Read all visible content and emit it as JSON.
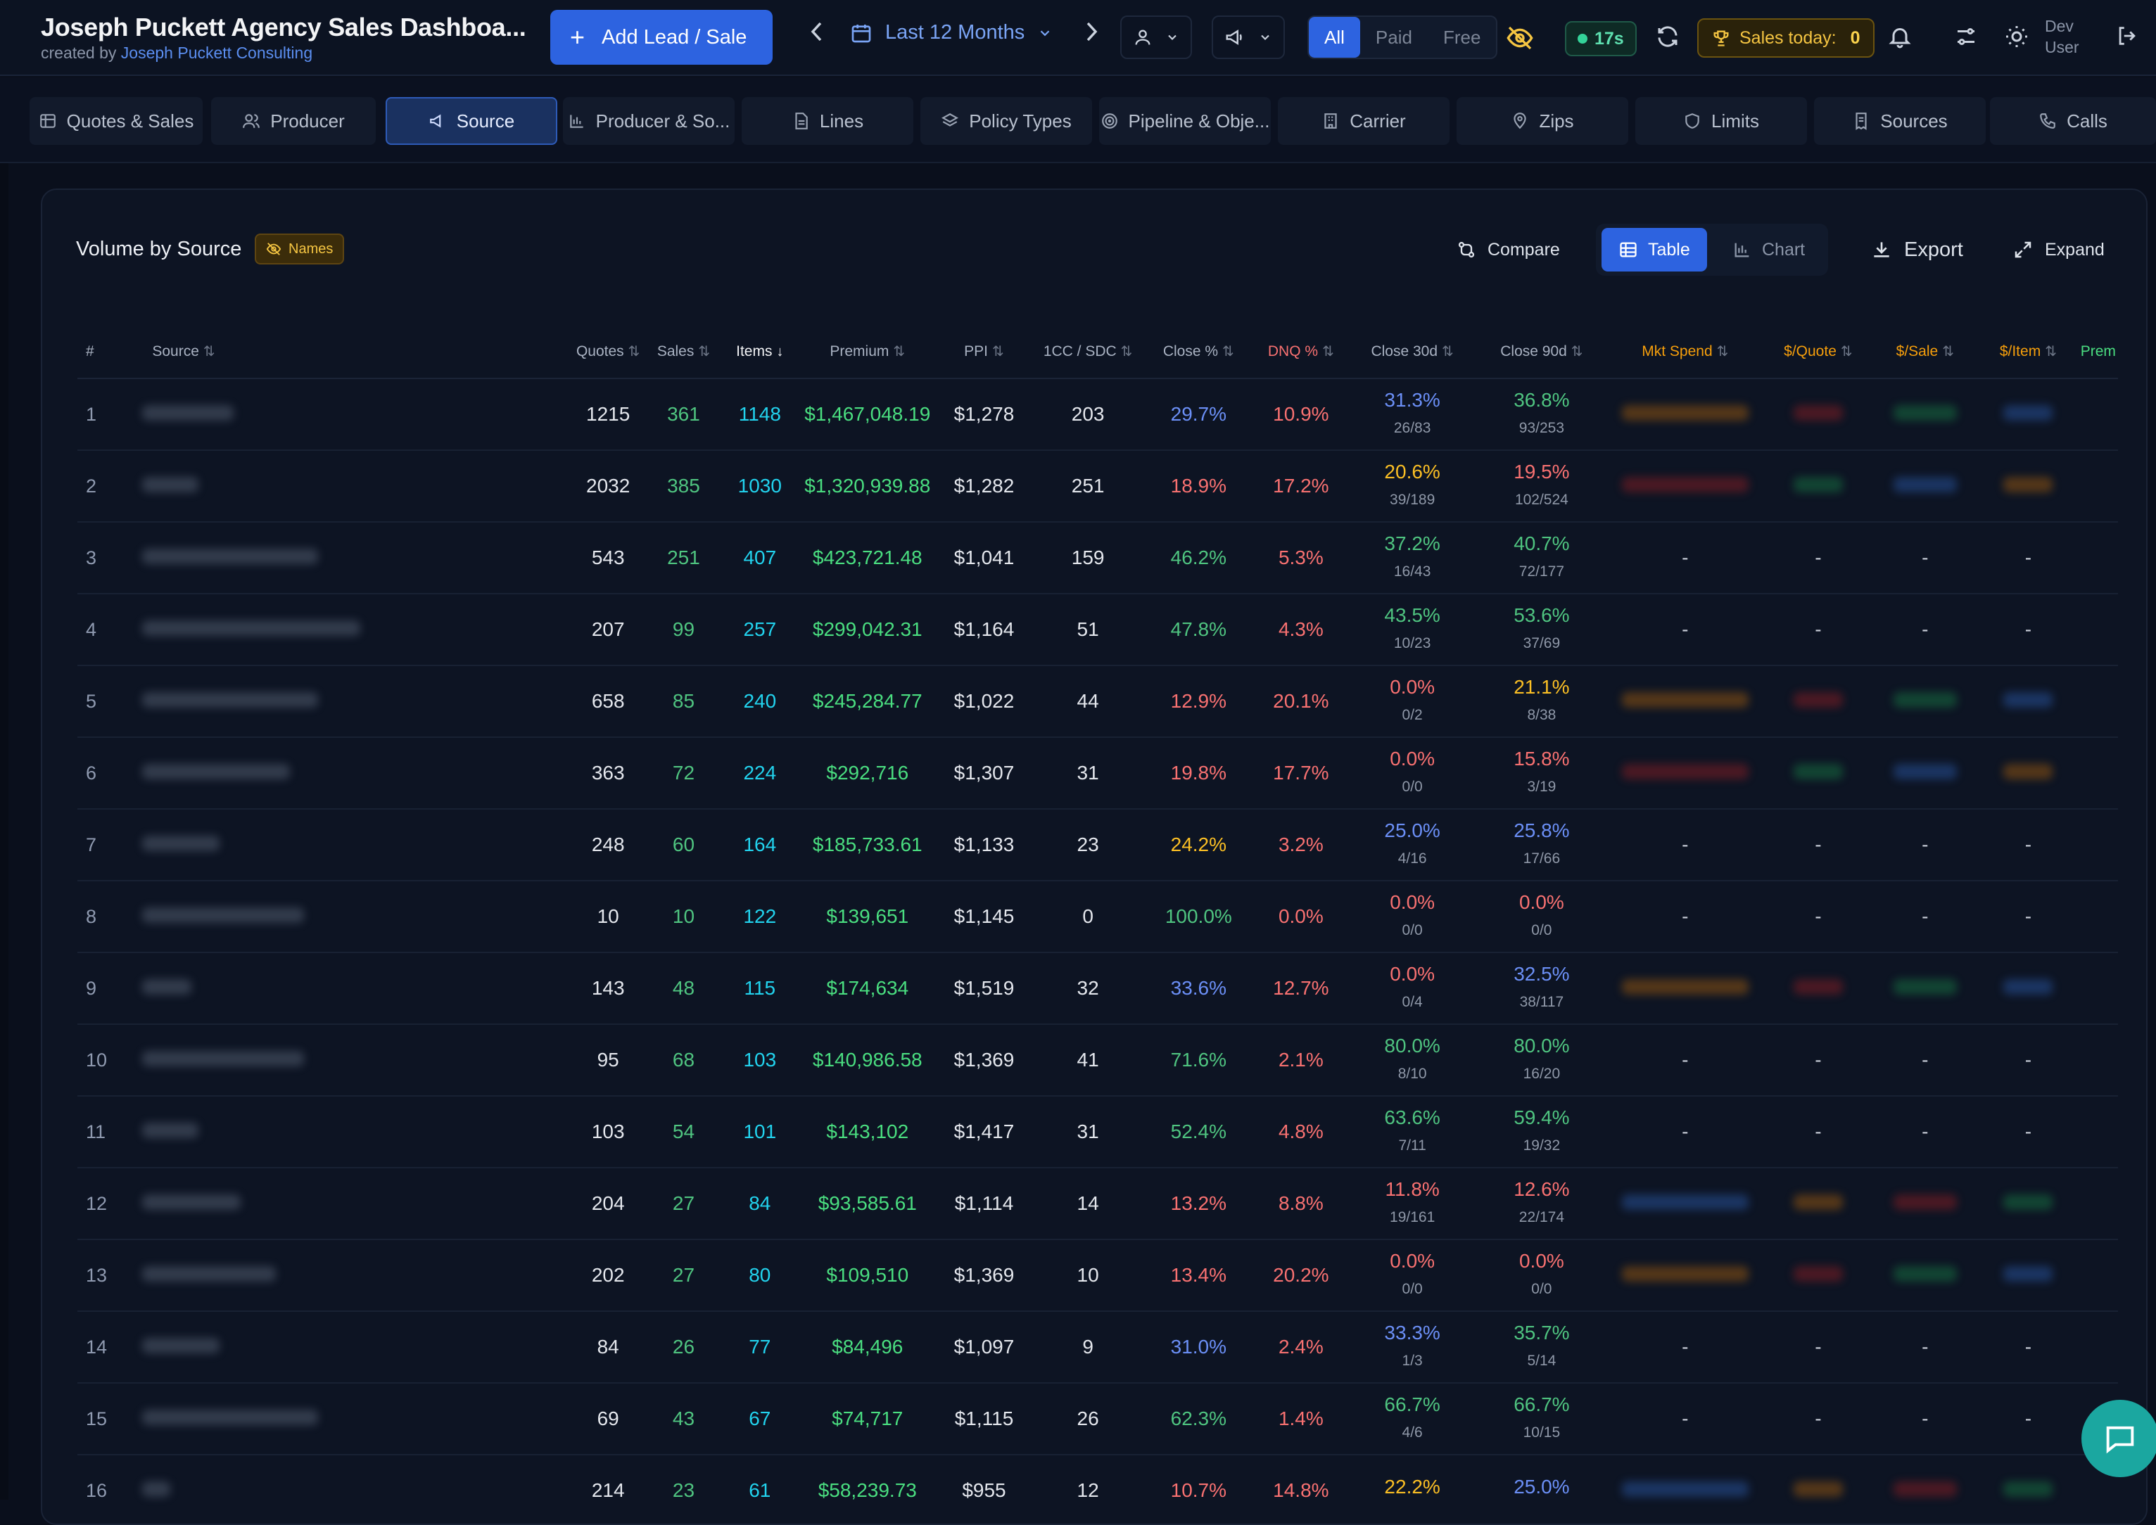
{
  "app": {
    "title": "Joseph Puckett Agency Sales Dashboa...",
    "created_by_prefix": "created by",
    "created_by_name": "Joseph Puckett Consulting"
  },
  "toolbar": {
    "add_label": "Add Lead / Sale",
    "date_range": "Last 12 Months",
    "filter_segment": [
      "All",
      "Paid",
      "Free"
    ],
    "timer": "17s",
    "sales_today_label": "Sales today:",
    "sales_today_value": "0",
    "user_line1": "Dev",
    "user_line2": "User"
  },
  "tabs": [
    {
      "label": "Quotes & Sales",
      "icon": "table-icon"
    },
    {
      "label": "Producer",
      "icon": "users-icon"
    },
    {
      "label": "Source",
      "icon": "megaphone-icon",
      "active": true
    },
    {
      "label": "Producer & So...",
      "icon": "bar-chart-icon"
    },
    {
      "label": "Lines",
      "icon": "file-icon"
    },
    {
      "label": "Policy Types",
      "icon": "layers-icon"
    },
    {
      "label": "Pipeline & Obje...",
      "icon": "target-icon"
    },
    {
      "label": "Carrier",
      "icon": "building-icon"
    },
    {
      "label": "Zips",
      "icon": "map-pin-icon"
    },
    {
      "label": "Limits",
      "icon": "shield-icon"
    },
    {
      "label": "Sources",
      "icon": "receipt-icon"
    },
    {
      "label": "Calls",
      "icon": "phone-icon"
    }
  ],
  "card": {
    "title": "Volume by Source",
    "badge": "Names",
    "compare_label": "Compare",
    "table_label": "Table",
    "chart_label": "Chart",
    "export_label": "Export",
    "expand_label": "Expand"
  },
  "columns": [
    "#",
    "Source",
    "Quotes",
    "Sales",
    "Items",
    "Premium",
    "PPI",
    "1CC / SDC",
    "Close %",
    "DNQ %",
    "Close 30d",
    "Close 90d",
    "Mkt Spend",
    "$/Quote",
    "$/Sale",
    "$/Item",
    "Prem"
  ],
  "rows": [
    {
      "rank": "1",
      "quotes": "1215",
      "sales": "361",
      "items": "1148",
      "premium": "$1,467,048.19",
      "ppi": "$1,278",
      "cc": "203",
      "close": "29.7%",
      "dnq": "10.9%",
      "c30": "31.3%",
      "c30s": "26/83",
      "c90": "36.8%",
      "c90s": "93/253",
      "dash": false
    },
    {
      "rank": "2",
      "quotes": "2032",
      "sales": "385",
      "items": "1030",
      "premium": "$1,320,939.88",
      "ppi": "$1,282",
      "cc": "251",
      "close": "18.9%",
      "dnq": "17.2%",
      "c30": "20.6%",
      "c30s": "39/189",
      "c90": "19.5%",
      "c90s": "102/524",
      "dash": false
    },
    {
      "rank": "3",
      "quotes": "543",
      "sales": "251",
      "items": "407",
      "premium": "$423,721.48",
      "ppi": "$1,041",
      "cc": "159",
      "close": "46.2%",
      "dnq": "5.3%",
      "c30": "37.2%",
      "c30s": "16/43",
      "c90": "40.7%",
      "c90s": "72/177",
      "dash": true
    },
    {
      "rank": "4",
      "quotes": "207",
      "sales": "99",
      "items": "257",
      "premium": "$299,042.31",
      "ppi": "$1,164",
      "cc": "51",
      "close": "47.8%",
      "dnq": "4.3%",
      "c30": "43.5%",
      "c30s": "10/23",
      "c90": "53.6%",
      "c90s": "37/69",
      "dash": true
    },
    {
      "rank": "5",
      "quotes": "658",
      "sales": "85",
      "items": "240",
      "premium": "$245,284.77",
      "ppi": "$1,022",
      "cc": "44",
      "close": "12.9%",
      "dnq": "20.1%",
      "c30": "0.0%",
      "c30s": "0/2",
      "c90": "21.1%",
      "c90s": "8/38",
      "dash": false
    },
    {
      "rank": "6",
      "quotes": "363",
      "sales": "72",
      "items": "224",
      "premium": "$292,716",
      "ppi": "$1,307",
      "cc": "31",
      "close": "19.8%",
      "dnq": "17.7%",
      "c30": "0.0%",
      "c30s": "0/0",
      "c90": "15.8%",
      "c90s": "3/19",
      "dash": false
    },
    {
      "rank": "7",
      "quotes": "248",
      "sales": "60",
      "items": "164",
      "premium": "$185,733.61",
      "ppi": "$1,133",
      "cc": "23",
      "close": "24.2%",
      "dnq": "3.2%",
      "c30": "25.0%",
      "c30s": "4/16",
      "c90": "25.8%",
      "c90s": "17/66",
      "dash": true
    },
    {
      "rank": "8",
      "quotes": "10",
      "sales": "10",
      "items": "122",
      "premium": "$139,651",
      "ppi": "$1,145",
      "cc": "0",
      "close": "100.0%",
      "dnq": "0.0%",
      "c30": "0.0%",
      "c30s": "0/0",
      "c90": "0.0%",
      "c90s": "0/0",
      "dash": true
    },
    {
      "rank": "9",
      "quotes": "143",
      "sales": "48",
      "items": "115",
      "premium": "$174,634",
      "ppi": "$1,519",
      "cc": "32",
      "close": "33.6%",
      "dnq": "12.7%",
      "c30": "0.0%",
      "c30s": "0/4",
      "c90": "32.5%",
      "c90s": "38/117",
      "dash": false
    },
    {
      "rank": "10",
      "quotes": "95",
      "sales": "68",
      "items": "103",
      "premium": "$140,986.58",
      "ppi": "$1,369",
      "cc": "41",
      "close": "71.6%",
      "dnq": "2.1%",
      "c30": "80.0%",
      "c30s": "8/10",
      "c90": "80.0%",
      "c90s": "16/20",
      "dash": true
    },
    {
      "rank": "11",
      "quotes": "103",
      "sales": "54",
      "items": "101",
      "premium": "$143,102",
      "ppi": "$1,417",
      "cc": "31",
      "close": "52.4%",
      "dnq": "4.8%",
      "c30": "63.6%",
      "c30s": "7/11",
      "c90": "59.4%",
      "c90s": "19/32",
      "dash": true
    },
    {
      "rank": "12",
      "quotes": "204",
      "sales": "27",
      "items": "84",
      "premium": "$93,585.61",
      "ppi": "$1,114",
      "cc": "14",
      "close": "13.2%",
      "dnq": "8.8%",
      "c30": "11.8%",
      "c30s": "19/161",
      "c90": "12.6%",
      "c90s": "22/174",
      "dash": false
    },
    {
      "rank": "13",
      "quotes": "202",
      "sales": "27",
      "items": "80",
      "premium": "$109,510",
      "ppi": "$1,369",
      "cc": "10",
      "close": "13.4%",
      "dnq": "20.2%",
      "c30": "0.0%",
      "c30s": "0/0",
      "c90": "0.0%",
      "c90s": "0/0",
      "dash": false
    },
    {
      "rank": "14",
      "quotes": "84",
      "sales": "26",
      "items": "77",
      "premium": "$84,496",
      "ppi": "$1,097",
      "cc": "9",
      "close": "31.0%",
      "dnq": "2.4%",
      "c30": "33.3%",
      "c30s": "1/3",
      "c90": "35.7%",
      "c90s": "5/14",
      "dash": true
    },
    {
      "rank": "15",
      "quotes": "69",
      "sales": "43",
      "items": "67",
      "premium": "$74,717",
      "ppi": "$1,115",
      "cc": "26",
      "close": "62.3%",
      "dnq": "1.4%",
      "c30": "66.7%",
      "c30s": "4/6",
      "c90": "66.7%",
      "c90s": "10/15",
      "dash": true
    },
    {
      "rank": "16",
      "quotes": "214",
      "sales": "23",
      "items": "61",
      "premium": "$58,239.73",
      "ppi": "$955",
      "cc": "12",
      "close": "10.7%",
      "dnq": "14.8%",
      "c30": "22.2%",
      "c30s": "",
      "c90": "25.0%",
      "c90s": "",
      "dash": false
    }
  ],
  "dash_symbol": "-"
}
